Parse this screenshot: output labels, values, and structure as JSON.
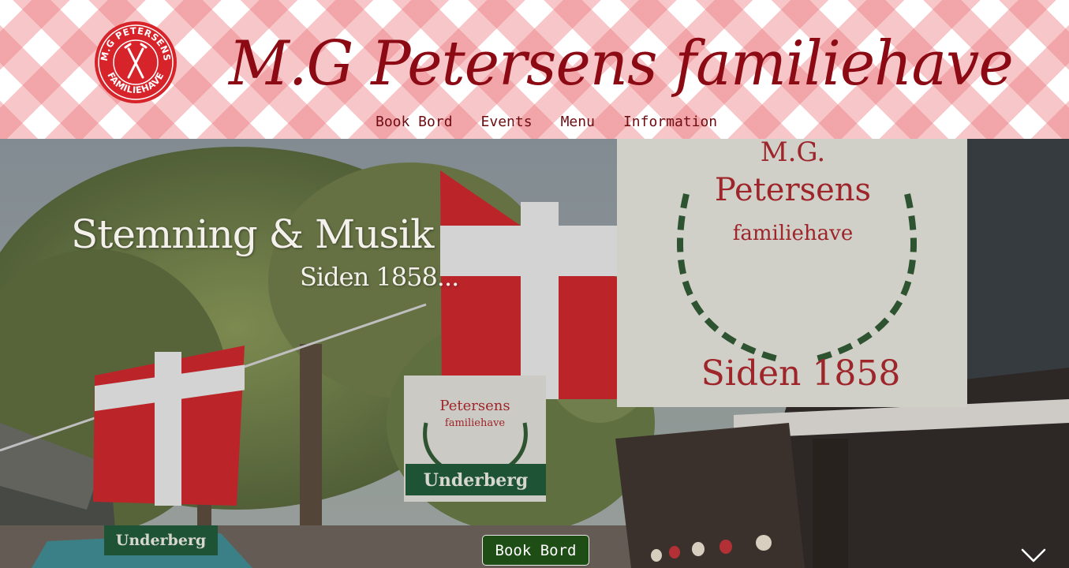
{
  "logo": {
    "icon": "fork-knife-icon",
    "ring_text": "M.G PETERSENS FAMILIEHAVE"
  },
  "site_title": "M.G Petersens familiehave",
  "nav": {
    "items": [
      {
        "label": "Book Bord"
      },
      {
        "label": "Events"
      },
      {
        "label": "Menu"
      },
      {
        "label": "Information"
      }
    ]
  },
  "hero": {
    "title": "Stemning & Musik",
    "subtitle": "Siden 1858...",
    "sign": {
      "line1": "M.G.",
      "line2": "Petersens",
      "line3": "familiehave",
      "line4": "Siden 1858"
    },
    "small_sign": {
      "line1": "Petersens",
      "line2": "familiehave"
    },
    "banner_text": "Underberg",
    "cta_label": "Book Bord",
    "scroll_icon": "chevron-down-icon"
  },
  "colors": {
    "brand_red": "#8b0a14",
    "nav_text": "#6e0c12",
    "cta_green": "#1f4d16",
    "gingham": "#ec787d"
  }
}
